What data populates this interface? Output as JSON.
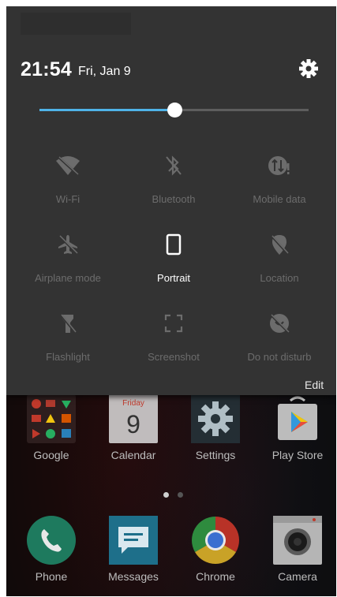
{
  "quick_settings": {
    "time": "21:54",
    "date": "Fri, Jan 9",
    "settings_icon": "gear-icon",
    "brightness": {
      "level": 0.5,
      "accent": "#4fb3e8"
    },
    "tiles": [
      {
        "label": "Wi-Fi",
        "icon": "wifi-off-icon",
        "active": false
      },
      {
        "label": "Bluetooth",
        "icon": "bluetooth-off-icon",
        "active": false
      },
      {
        "label": "Mobile data",
        "icon": "mobile-data-icon",
        "active": false
      },
      {
        "label": "Airplane mode",
        "icon": "airplane-icon",
        "active": false
      },
      {
        "label": "Portrait",
        "icon": "portrait-phone-icon",
        "active": true
      },
      {
        "label": "Location",
        "icon": "location-off-icon",
        "active": false
      },
      {
        "label": "Flashlight",
        "icon": "flashlight-off-icon",
        "active": false
      },
      {
        "label": "Screenshot",
        "icon": "screenshot-icon",
        "active": false
      },
      {
        "label": "Do not disturb",
        "icon": "do-not-disturb-icon",
        "active": false
      }
    ],
    "edit_label": "Edit"
  },
  "home": {
    "apps_row1": [
      {
        "label": "Google",
        "icon": "google-folder-icon"
      },
      {
        "label": "Calendar",
        "icon": "calendar-icon",
        "day_name": "Friday",
        "day_number": "9"
      },
      {
        "label": "Settings",
        "icon": "settings-app-icon"
      },
      {
        "label": "Play Store",
        "icon": "play-store-icon"
      }
    ],
    "page_indicator": {
      "pages": 2,
      "current": 1
    },
    "dock": [
      {
        "label": "Phone",
        "icon": "phone-icon"
      },
      {
        "label": "Messages",
        "icon": "messages-icon"
      },
      {
        "label": "Chrome",
        "icon": "chrome-icon"
      },
      {
        "label": "Camera",
        "icon": "camera-icon"
      }
    ]
  }
}
